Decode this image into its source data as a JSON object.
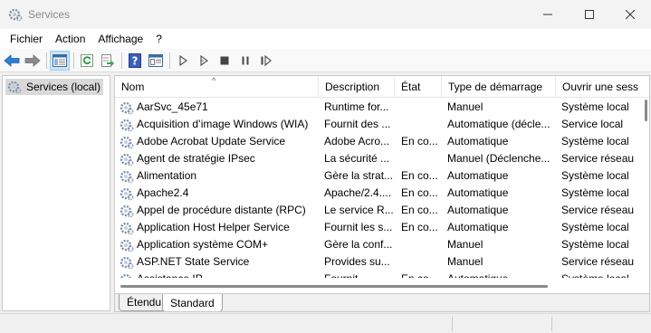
{
  "window": {
    "title": "Services",
    "icon": "services-gear-icon",
    "controls": [
      "minimize",
      "maximize",
      "close"
    ]
  },
  "menubar": {
    "items": [
      "Fichier",
      "Action",
      "Affichage",
      "?"
    ]
  },
  "toolbar": {
    "buttons": [
      "back-arrow-icon",
      "forward-arrow-icon",
      "show-hide-console-tree-icon",
      "refresh-icon",
      "export-list-icon",
      "help-icon",
      "properties-icon",
      "start-service-icon",
      "start-service-alt-icon",
      "stop-service-icon",
      "pause-service-icon",
      "resume-service-icon"
    ]
  },
  "tree": {
    "selected_label": "Services (local)"
  },
  "table": {
    "columns": [
      "Nom",
      "Description",
      "État",
      "Type de démarrage",
      "Ouvrir une sess"
    ],
    "rows": [
      {
        "name": "AarSvc_45e71",
        "description": "Runtime for...",
        "state": "",
        "startup": "Manuel",
        "logon": "Système local"
      },
      {
        "name": "Acquisition d’image Windows (WIA)",
        "description": "Fournit des ...",
        "state": "",
        "startup": "Automatique (décle...",
        "logon": "Service local"
      },
      {
        "name": "Adobe Acrobat Update Service",
        "description": "Adobe Acro...",
        "state": "En co...",
        "startup": "Automatique",
        "logon": "Système local"
      },
      {
        "name": "Agent de stratégie IPsec",
        "description": "La sécurité ...",
        "state": "",
        "startup": "Manuel (Déclenche...",
        "logon": "Service réseau"
      },
      {
        "name": "Alimentation",
        "description": "Gère la strat...",
        "state": "En co...",
        "startup": "Automatique",
        "logon": "Système local"
      },
      {
        "name": "Apache2.4",
        "description": "Apache/2.4....",
        "state": "En co...",
        "startup": "Automatique",
        "logon": "Système local"
      },
      {
        "name": "Appel de procédure distante (RPC)",
        "description": "Le service R...",
        "state": "En co...",
        "startup": "Automatique",
        "logon": "Service réseau"
      },
      {
        "name": "Application Host Helper Service",
        "description": "Fournit les s...",
        "state": "En co...",
        "startup": "Automatique",
        "logon": "Système local"
      },
      {
        "name": "Application système COM+",
        "description": "Gère la conf...",
        "state": "",
        "startup": "Manuel",
        "logon": "Système local"
      },
      {
        "name": "ASP.NET State Service",
        "description": "Provides su...",
        "state": "",
        "startup": "Manuel",
        "logon": "Service réseau"
      },
      {
        "name": "Assistance IP",
        "description": "Fournit...",
        "state": "En co...",
        "startup": "Automatique",
        "logon": "Système local"
      }
    ]
  },
  "tabs": {
    "extended": "Étendu",
    "standard": "Standard",
    "active": "Standard"
  }
}
